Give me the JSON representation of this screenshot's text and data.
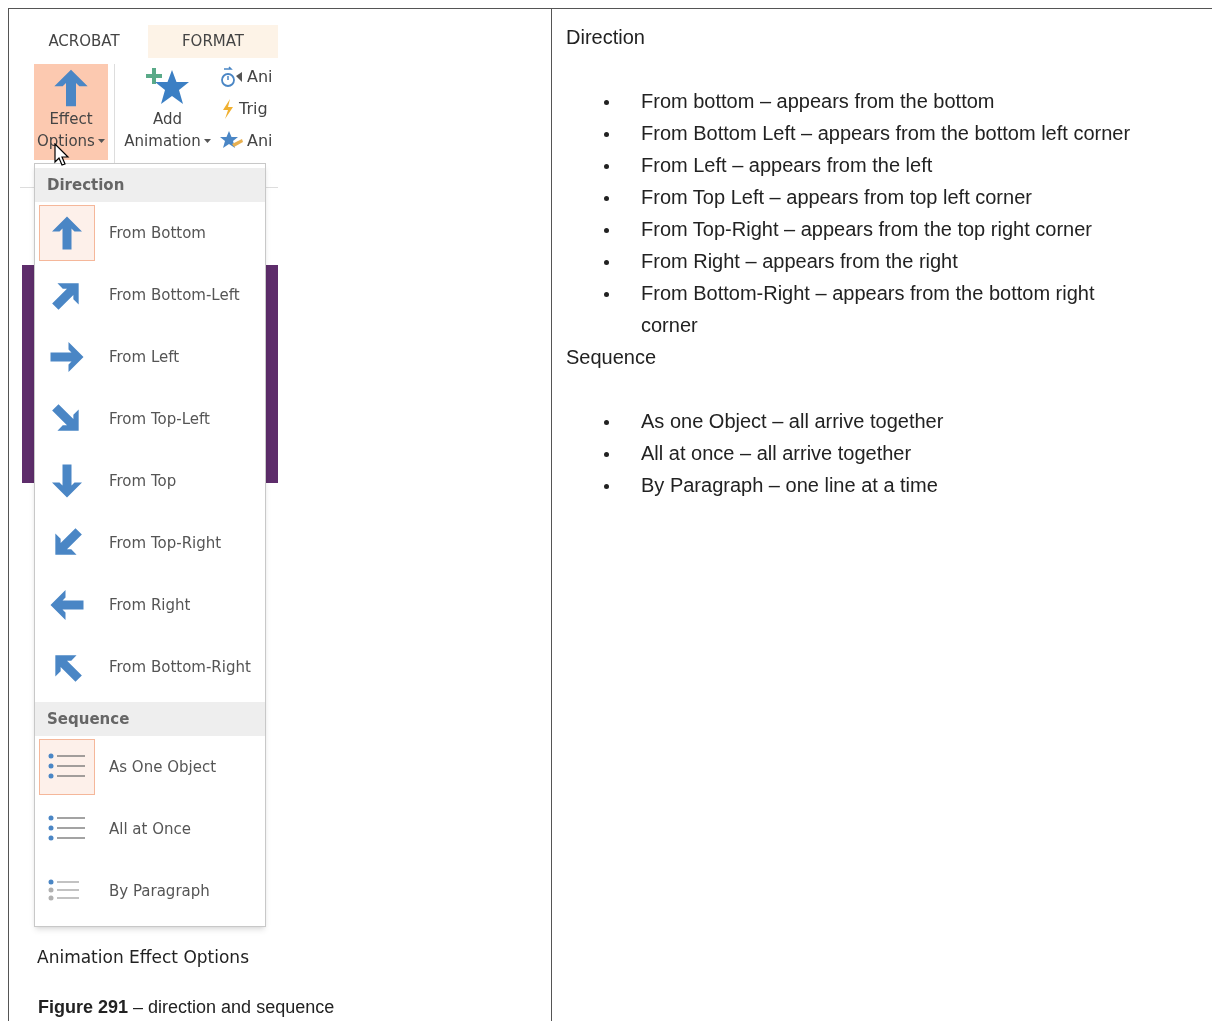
{
  "screenshot": {
    "tabs": [
      {
        "label": "ACROBAT",
        "selected": false
      },
      {
        "label": "FORMAT",
        "selected": true
      }
    ],
    "effect_options": {
      "line1": "Effect",
      "line2": "Options",
      "selected": true
    },
    "add_animation": {
      "line1": "Add",
      "line2": "Animation"
    },
    "small_commands": [
      {
        "kind": "timer",
        "label": "Ani"
      },
      {
        "kind": "trigger",
        "label": "Trig"
      },
      {
        "kind": "painter",
        "label": "Ani"
      }
    ],
    "menu": [
      {
        "title": "Direction",
        "items": [
          {
            "kind": "up",
            "label": "From Bottom",
            "selected": true
          },
          {
            "kind": "up-right",
            "label": "From Bottom-Left",
            "selected": false
          },
          {
            "kind": "right",
            "label": "From Left",
            "selected": false
          },
          {
            "kind": "down-right",
            "label": "From Top-Left",
            "selected": false
          },
          {
            "kind": "down",
            "label": "From Top",
            "selected": false
          },
          {
            "kind": "down-left",
            "label": "From Top-Right",
            "selected": false
          },
          {
            "kind": "left",
            "label": "From Right",
            "selected": false
          },
          {
            "kind": "up-left",
            "label": "From Bottom-Right",
            "selected": false
          }
        ]
      },
      {
        "title": "Sequence",
        "items": [
          {
            "kind": "one-object",
            "label": "As One Object",
            "selected": true
          },
          {
            "kind": "all-at-once",
            "label": "All at Once",
            "selected": false
          },
          {
            "kind": "by-paragraph",
            "label": "By Paragraph",
            "selected": false
          }
        ]
      }
    ],
    "caption": "Animation Effect Options"
  },
  "figure_caption": "**Figure 291** – direction and sequence",
  "sections": [
    {
      "heading": "Direction",
      "bullets": [
        "From bottom – appears from the bottom",
        "From Bottom Left – appears from the bottom left corner",
        "From Left – appears from the left",
        "From Top Left – appears from top left corner",
        "From Top-Right – appears from the top right corner",
        "From Right – appears from the right",
        "From Bottom-Right – appears from the bottom right corner"
      ]
    },
    {
      "heading": "Sequence",
      "bullets": [
        "As one Object – all arrive together",
        "All at once – all arrive together",
        "By Paragraph – one line at a time"
      ]
    }
  ]
}
